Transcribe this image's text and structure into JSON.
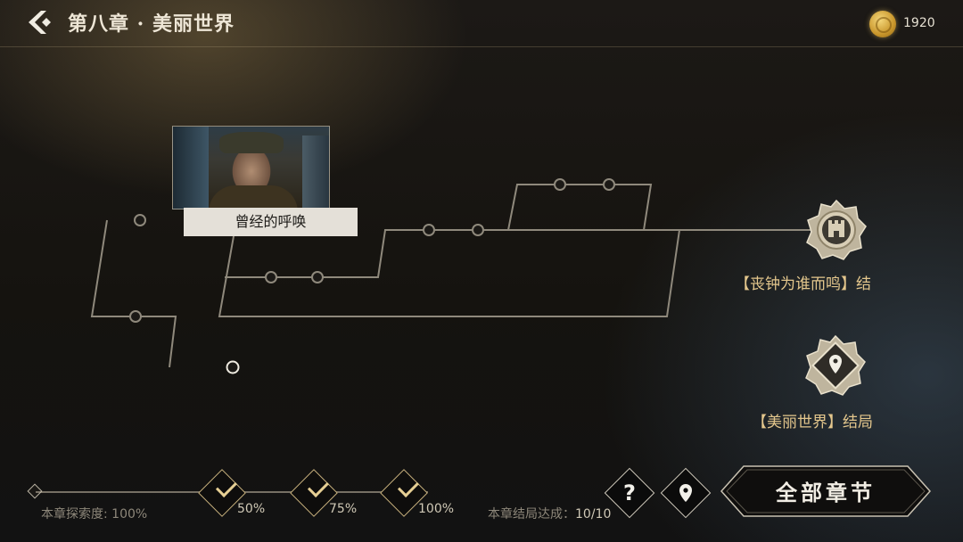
{
  "header": {
    "back_icon": "back-chevron-icon",
    "title": "第八章 · 美丽世界",
    "coin_icon": "gold-coin-icon",
    "coin_count": "1920"
  },
  "story_tree": {
    "current_node": {
      "label": "曾经的呼唤",
      "thumbnail": "man-in-military-cap-portrait"
    },
    "endings": [
      {
        "label": "【丧钟为谁而鸣】结",
        "icon": "fortress-emblem-icon"
      },
      {
        "label": "【美丽世界】结局",
        "icon": "location-pin-emblem-icon"
      }
    ]
  },
  "footer": {
    "explore_label": "本章探索度:",
    "explore_value": "100%",
    "milestones": [
      {
        "percent": "50%",
        "achieved": true
      },
      {
        "percent": "75%",
        "achieved": true
      },
      {
        "percent": "100%",
        "achieved": true
      }
    ],
    "endings_label": "本章结局达成：",
    "endings_value": "10/10",
    "help_icon": "question-mark-icon",
    "locate_icon": "location-pin-icon",
    "all_chapters_label": "全部章节"
  },
  "colors": {
    "gold_accent": "#e3c68c",
    "line": "#8f897c",
    "active_line": "#e8e3d6"
  }
}
